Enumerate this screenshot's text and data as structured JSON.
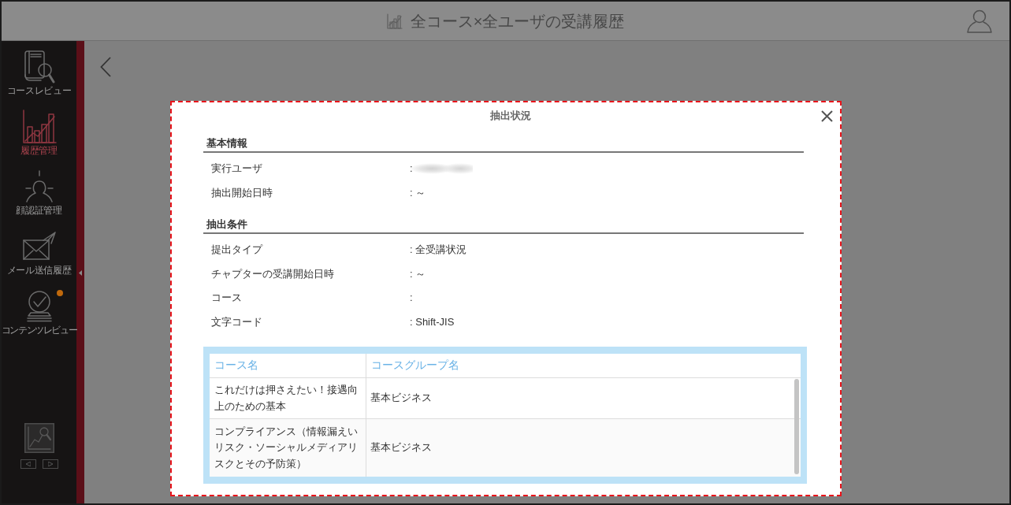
{
  "header": {
    "title": "全コース×全ユーザの受講履歴"
  },
  "sidebar": {
    "items": [
      {
        "label": "コースレビュー",
        "kind": "course-review",
        "selected": false,
        "notification": false
      },
      {
        "label": "履歴管理",
        "kind": "history",
        "selected": true,
        "notification": false
      },
      {
        "label": "顔認証管理",
        "kind": "face-auth",
        "selected": false,
        "notification": false
      },
      {
        "label": "メール送信履歴",
        "kind": "mail",
        "selected": false,
        "notification": false
      },
      {
        "label": "コンテンツレビュー",
        "kind": "content-review",
        "selected": false,
        "notification": true
      }
    ]
  },
  "modal": {
    "title": "抽出状況",
    "sections": [
      {
        "heading": "基本情報",
        "rows": [
          {
            "label": "実行ユーザ",
            "value": ":",
            "redacted": true
          },
          {
            "label": "抽出開始日時",
            "value": ": ～",
            "redacted": false
          }
        ]
      },
      {
        "heading": "抽出条件",
        "rows": [
          {
            "label": "提出タイプ",
            "value": ": 全受講状況",
            "redacted": false
          },
          {
            "label": "チャプターの受講開始日時",
            "value": ": ～",
            "redacted": false
          },
          {
            "label": "コース",
            "value": ":",
            "redacted": false
          },
          {
            "label": "文字コード",
            "value": ": Shift-JIS",
            "redacted": false
          }
        ]
      }
    ],
    "table": {
      "columns": [
        "コース名",
        "コースグループ名"
      ],
      "rows": [
        {
          "cells": [
            "これだけは押さえたい！接遇向上のための基本",
            "基本ビジネス"
          ]
        },
        {
          "cells": [
            "コンプライアンス（情報漏えいリスク・ソーシャルメディアリスクとその予防策）",
            "基本ビジネス"
          ]
        }
      ]
    }
  }
}
